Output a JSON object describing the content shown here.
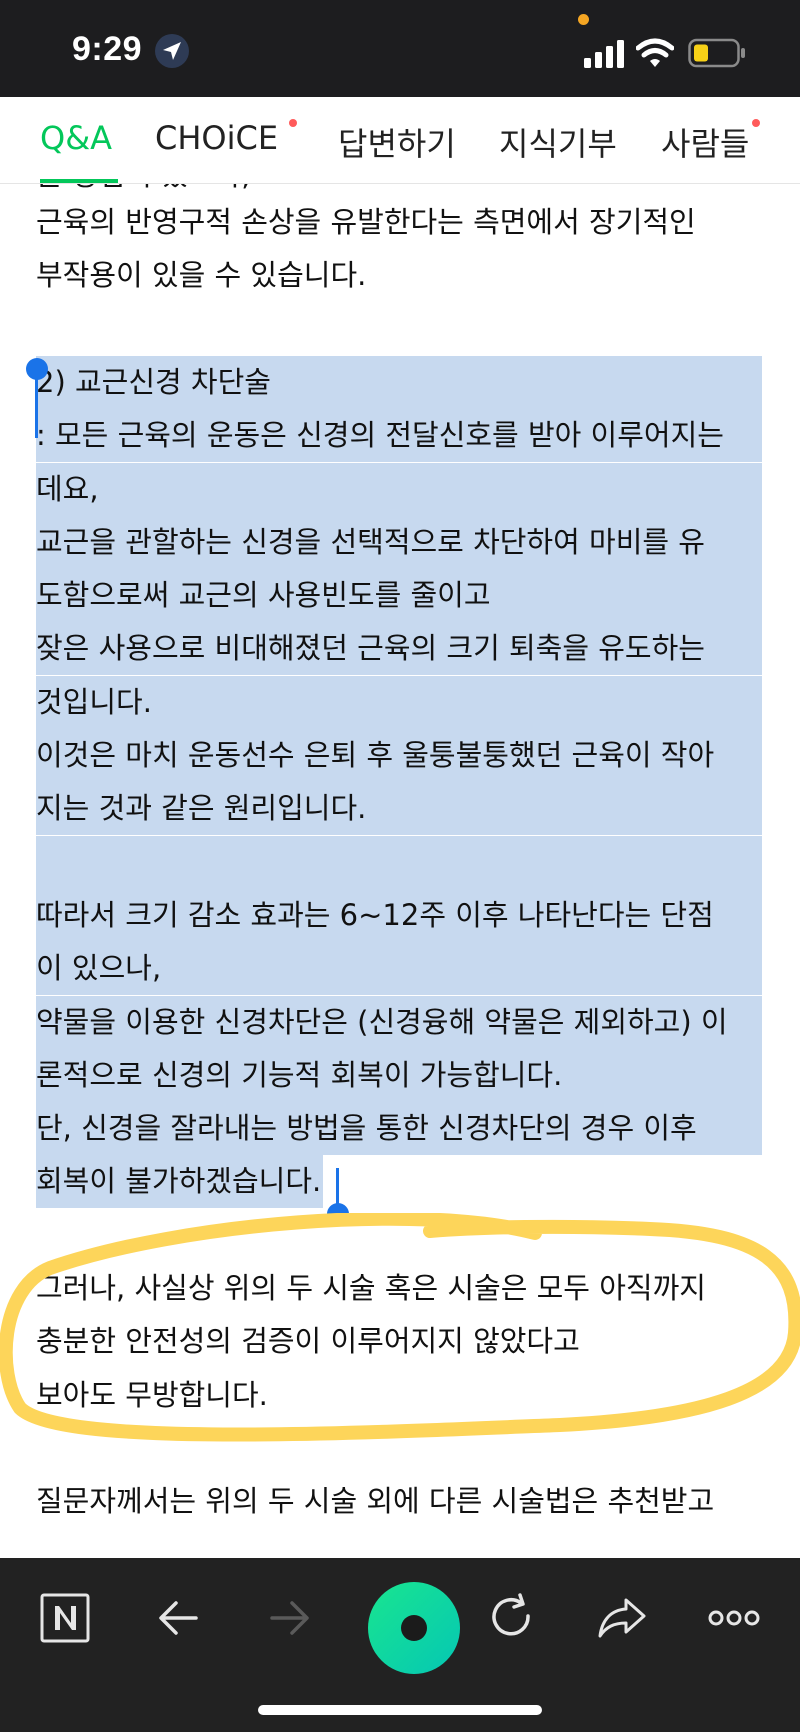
{
  "status_bar": {
    "time": "9:29"
  },
  "tabs": [
    {
      "label": "Q&A",
      "active": true,
      "dot": false
    },
    {
      "label": "CHOiCE",
      "active": false,
      "dot": true
    },
    {
      "label": "답변하기",
      "active": false,
      "dot": false
    },
    {
      "label": "지식기부",
      "active": false,
      "dot": false
    },
    {
      "label": "사람들",
      "active": false,
      "dot": true
    }
  ],
  "article": {
    "partial_line": "는 장점이 있으나,",
    "lines": [
      {
        "text": "근육의 반영구적 손상을 유발한다는 측면에서 장기적인",
        "selected": false
      },
      {
        "text": "부작용이 있을 수 있습니다.",
        "selected": false
      },
      {
        "text": "",
        "selected": false
      },
      {
        "text": "2) 교근신경 차단술",
        "selected": true
      },
      {
        "text": ": 모든 근육의 운동은 신경의 전달신호를 받아 이루어지는",
        "selected": true
      },
      {
        "text": "데요,",
        "selected": true
      },
      {
        "text": "교근을 관할하는 신경을 선택적으로 차단하여 마비를 유",
        "selected": true
      },
      {
        "text": "도함으로써 교근의 사용빈도를 줄이고",
        "selected": true
      },
      {
        "text": "잦은 사용으로 비대해졌던 근육의 크기 퇴축을 유도하는",
        "selected": true
      },
      {
        "text": "것입니다.",
        "selected": true
      },
      {
        "text": "이것은 마치 운동선수 은퇴 후 울퉁불퉁했던 근육이 작아",
        "selected": true
      },
      {
        "text": "지는 것과 같은 원리입니다.",
        "selected": true
      },
      {
        "text": "",
        "selected": true
      },
      {
        "text": "따라서 크기 감소 효과는 6~12주 이후 나타난다는 단점",
        "selected": true
      },
      {
        "text": "이 있으나,",
        "selected": true
      },
      {
        "text": "약물을 이용한 신경차단은 (신경융해 약물은 제외하고) 이",
        "selected": true
      },
      {
        "text": "론적으로 신경의 기능적 회복이 가능합니다.",
        "selected": true
      },
      {
        "text": "단, 신경을 잘라내는 방법을 통한 신경차단의 경우 이후",
        "selected": true
      },
      {
        "text": "회복이 불가하겠습니다.",
        "selected": true
      },
      {
        "text": "",
        "selected": false
      },
      {
        "text": "그러나, 사실상 위의 두 시술 혹은 시술은 모두 아직까지",
        "selected": false
      },
      {
        "text": "충분한 안전성의 검증이 이루어지지 않았다고",
        "selected": false
      },
      {
        "text": "보아도 무방합니다.",
        "selected": false
      },
      {
        "text": "",
        "selected": false
      },
      {
        "text": "질문자께서는 위의 두 시술 외에 다른 시술법은 추천받고",
        "selected": false
      }
    ]
  },
  "colors": {
    "accent": "#03c75a",
    "selection": "#c7d9ef",
    "highlight_loop": "#fdd55a",
    "handle": "#1a73e8"
  }
}
